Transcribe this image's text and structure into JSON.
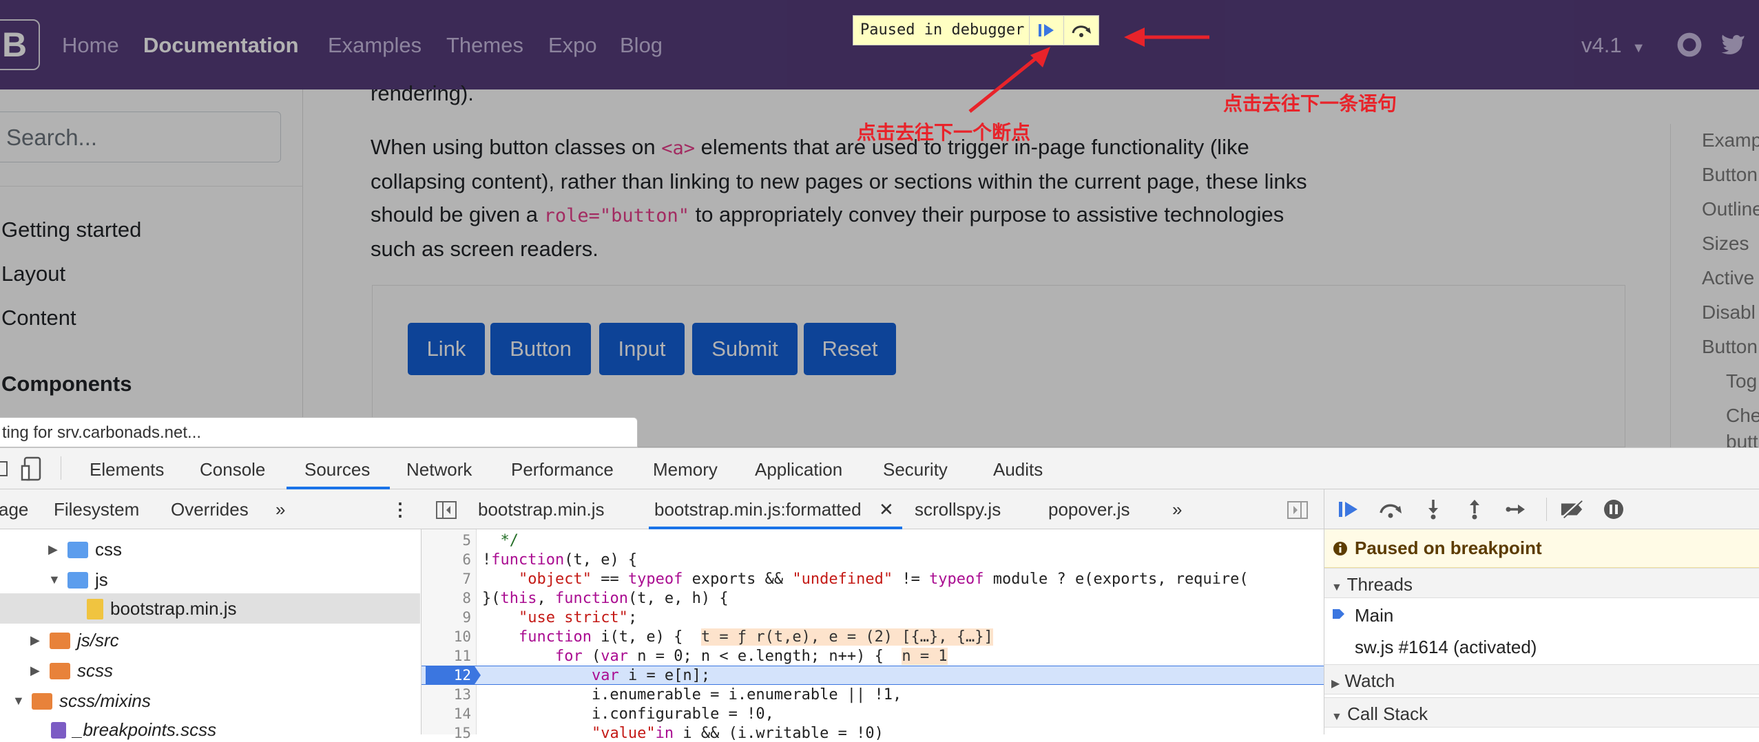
{
  "navbar": {
    "brand": "B",
    "links": [
      "Home",
      "Documentation",
      "Examples",
      "Themes",
      "Expo",
      "Blog"
    ],
    "active": "Documentation",
    "version": "v4.1",
    "bg_color": "#563d7c"
  },
  "sidebar": {
    "search_placeholder": "Search...",
    "items": [
      "Getting started",
      "Layout",
      "Content",
      "Components"
    ]
  },
  "content": {
    "para_top": "rendering).",
    "para_1": "When using button classes on ",
    "code_a": "<a>",
    "para_2": " elements that are used to trigger in-page functionality (like",
    "para_line2": "collapsing content), rather than linking to new pages or sections within the current page, these links",
    "para_3": "should be given a ",
    "code_role": "role=\"button\"",
    "para_4": " to appropriately convey their purpose to assistive technologies",
    "para_line4": "such as screen readers.",
    "buttons": [
      "Link",
      "Button",
      "Input",
      "Submit",
      "Reset"
    ]
  },
  "toc": [
    "Examp",
    "Button",
    "Outline",
    "Sizes",
    "Active",
    "Disabl",
    "Button",
    "Tog",
    "Che",
    "butt"
  ],
  "status_bar": "ting for srv.carbonads.net...",
  "debugger_banner": {
    "text": "Paused in debugger"
  },
  "annotations": {
    "next_breakpoint": "点击去往下一个断点",
    "next_statement": "点击去往下一条语句",
    "color": "#e8232a"
  },
  "devtools": {
    "tabs": [
      "Elements",
      "Console",
      "Sources",
      "Network",
      "Performance",
      "Memory",
      "Application",
      "Security",
      "Audits"
    ],
    "active_tab": "Sources",
    "nav_subtabs": [
      "age",
      "Filesystem",
      "Overrides",
      "»"
    ],
    "tree": [
      {
        "label": "css",
        "type": "folder",
        "color": "blue"
      },
      {
        "label": "js",
        "type": "folder",
        "color": "blue"
      },
      {
        "label": "bootstrap.min.js",
        "type": "file"
      },
      {
        "label": "js/src",
        "type": "folder",
        "color": "orange"
      },
      {
        "label": "scss",
        "type": "folder",
        "color": "orange"
      },
      {
        "label": "scss/mixins",
        "type": "folder",
        "color": "orange"
      },
      {
        "label": "_breakpoints.scss",
        "type": "file"
      }
    ],
    "editor_tabs": [
      "bootstrap.min.js",
      "bootstrap.min.js:formatted",
      "scrollspy.js",
      "popover.js",
      "»"
    ],
    "line_numbers": [
      "5",
      "6",
      "7",
      "8",
      "9",
      "10",
      "11",
      "12",
      "13",
      "14",
      "15"
    ],
    "inline_vals": {
      "line10": "t = ƒ r(t,e), e = (2) [{…}, {…}]",
      "line11": "n = 1"
    },
    "paused_on": "Paused on breakpoint",
    "sections": {
      "threads": "Threads",
      "watch": "Watch",
      "call_stack": "Call Stack"
    },
    "threads": [
      "Main",
      "sw.js #1614 (activated)"
    ]
  }
}
